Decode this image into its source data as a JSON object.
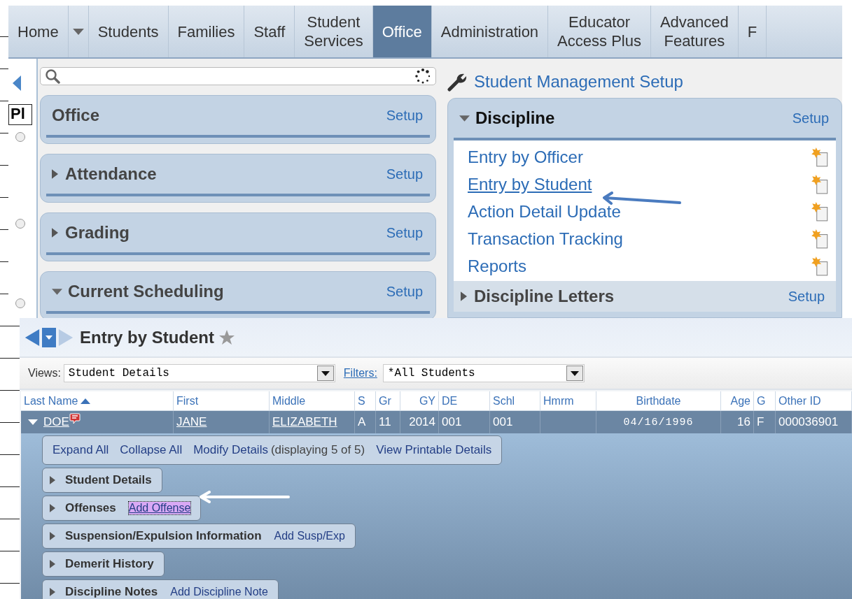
{
  "nav_tabs": [
    {
      "label": "Home",
      "selected": false,
      "kind": "tab"
    },
    {
      "kind": "dropdown",
      "selected": false
    },
    {
      "label": "Students",
      "selected": false,
      "kind": "tab"
    },
    {
      "label": "Families",
      "selected": false,
      "kind": "tab"
    },
    {
      "label": "Staff",
      "selected": false,
      "kind": "tab"
    },
    {
      "label": "Student\nServices",
      "selected": false,
      "kind": "tab"
    },
    {
      "label": "Office",
      "selected": true,
      "kind": "tab"
    },
    {
      "label": "Administration",
      "selected": false,
      "kind": "tab"
    },
    {
      "label": "Educator\nAccess Plus",
      "selected": false,
      "kind": "tab"
    },
    {
      "label": "Advanced\nFeatures",
      "selected": false,
      "kind": "tab"
    },
    {
      "label": "F",
      "selected": false,
      "kind": "tab"
    }
  ],
  "background_page": {
    "column_header": "Pl",
    "radios": [
      {
        "selected": false
      },
      {
        "selected": false
      },
      {
        "selected": false
      }
    ]
  },
  "setup_link": "Student Management Setup",
  "left_panels": [
    {
      "title": "Office",
      "action": "Setup"
    },
    {
      "title": "Attendance",
      "action": "Setup",
      "expanded": false
    },
    {
      "title": "Grading",
      "action": "Setup",
      "expanded": false
    },
    {
      "title": "Current Scheduling",
      "action": "Setup",
      "expanded": true
    }
  ],
  "discipline": {
    "title": "Discipline",
    "action": "Setup",
    "expanded": true,
    "items": [
      {
        "label": "Entry by Officer",
        "hovered": false
      },
      {
        "label": "Entry by Student",
        "hovered": true
      },
      {
        "label": "Action Detail Update",
        "hovered": false
      },
      {
        "label": "Transaction Tracking",
        "hovered": false
      },
      {
        "label": "Reports",
        "hovered": false
      }
    ],
    "sub_panel": {
      "title": "Discipline Letters",
      "action": "Setup"
    }
  },
  "entry_page": {
    "title": "Entry by Student",
    "views_label": "Views:",
    "views_value": "Student Details",
    "filters_label": "Filters:",
    "filters_value": "*All Students",
    "columns": [
      {
        "label": "Last Name",
        "sorted": true
      },
      {
        "label": "First",
        "sorted": false
      },
      {
        "label": "Middle",
        "sorted": false
      },
      {
        "label": "S",
        "sorted": false
      },
      {
        "label": "Gr",
        "sorted": false
      },
      {
        "label": "GY",
        "sorted": false
      },
      {
        "label": "DE",
        "sorted": false
      },
      {
        "label": "Schl",
        "sorted": false
      },
      {
        "label": "Hmrm",
        "sorted": false
      },
      {
        "label": "Birthdate",
        "sorted": false
      },
      {
        "label": "Age",
        "sorted": false
      },
      {
        "label": "G",
        "sorted": false
      },
      {
        "label": "Other ID",
        "sorted": false
      }
    ],
    "row": {
      "expanded": true,
      "has_note": true,
      "cells": [
        {
          "text": "DOE",
          "link": true
        },
        {
          "text": "JANE",
          "link": true
        },
        {
          "text": "ELIZABETH",
          "link": true
        },
        {
          "text": "A",
          "link": false
        },
        {
          "text": "11",
          "link": false
        },
        {
          "text": "2014",
          "link": false
        },
        {
          "text": "001",
          "link": false
        },
        {
          "text": "001",
          "link": false
        },
        {},
        {
          "text": "04/16/1996",
          "link": false,
          "kind": "mono"
        },
        {
          "text": "16",
          "link": false
        },
        {
          "text": "F",
          "link": false
        },
        {
          "text": "000036901",
          "link": false
        }
      ]
    },
    "toolbar": [
      {
        "text": "Expand All",
        "kind": "link"
      },
      {
        "text": "Collapse All",
        "kind": "link"
      },
      {
        "text": "Modify Details",
        "kind": "link"
      },
      {
        "text": "(displaying 5 of 5)",
        "kind": "note"
      },
      {
        "text": "View Printable Details",
        "kind": "link"
      }
    ],
    "sections": [
      {
        "title": "Student Details",
        "expanded": false
      },
      {
        "title": "Offenses",
        "expanded": false,
        "action": "Add Offense",
        "focused": true
      },
      {
        "title": "Suspension/Expulsion Information",
        "expanded": false,
        "action": "Add Susp/Exp",
        "focused": false
      },
      {
        "title": "Demerit History",
        "expanded": false
      },
      {
        "title": "Discipline Notes",
        "expanded": false,
        "action": "Add Discipline Note",
        "focused": false
      }
    ]
  }
}
